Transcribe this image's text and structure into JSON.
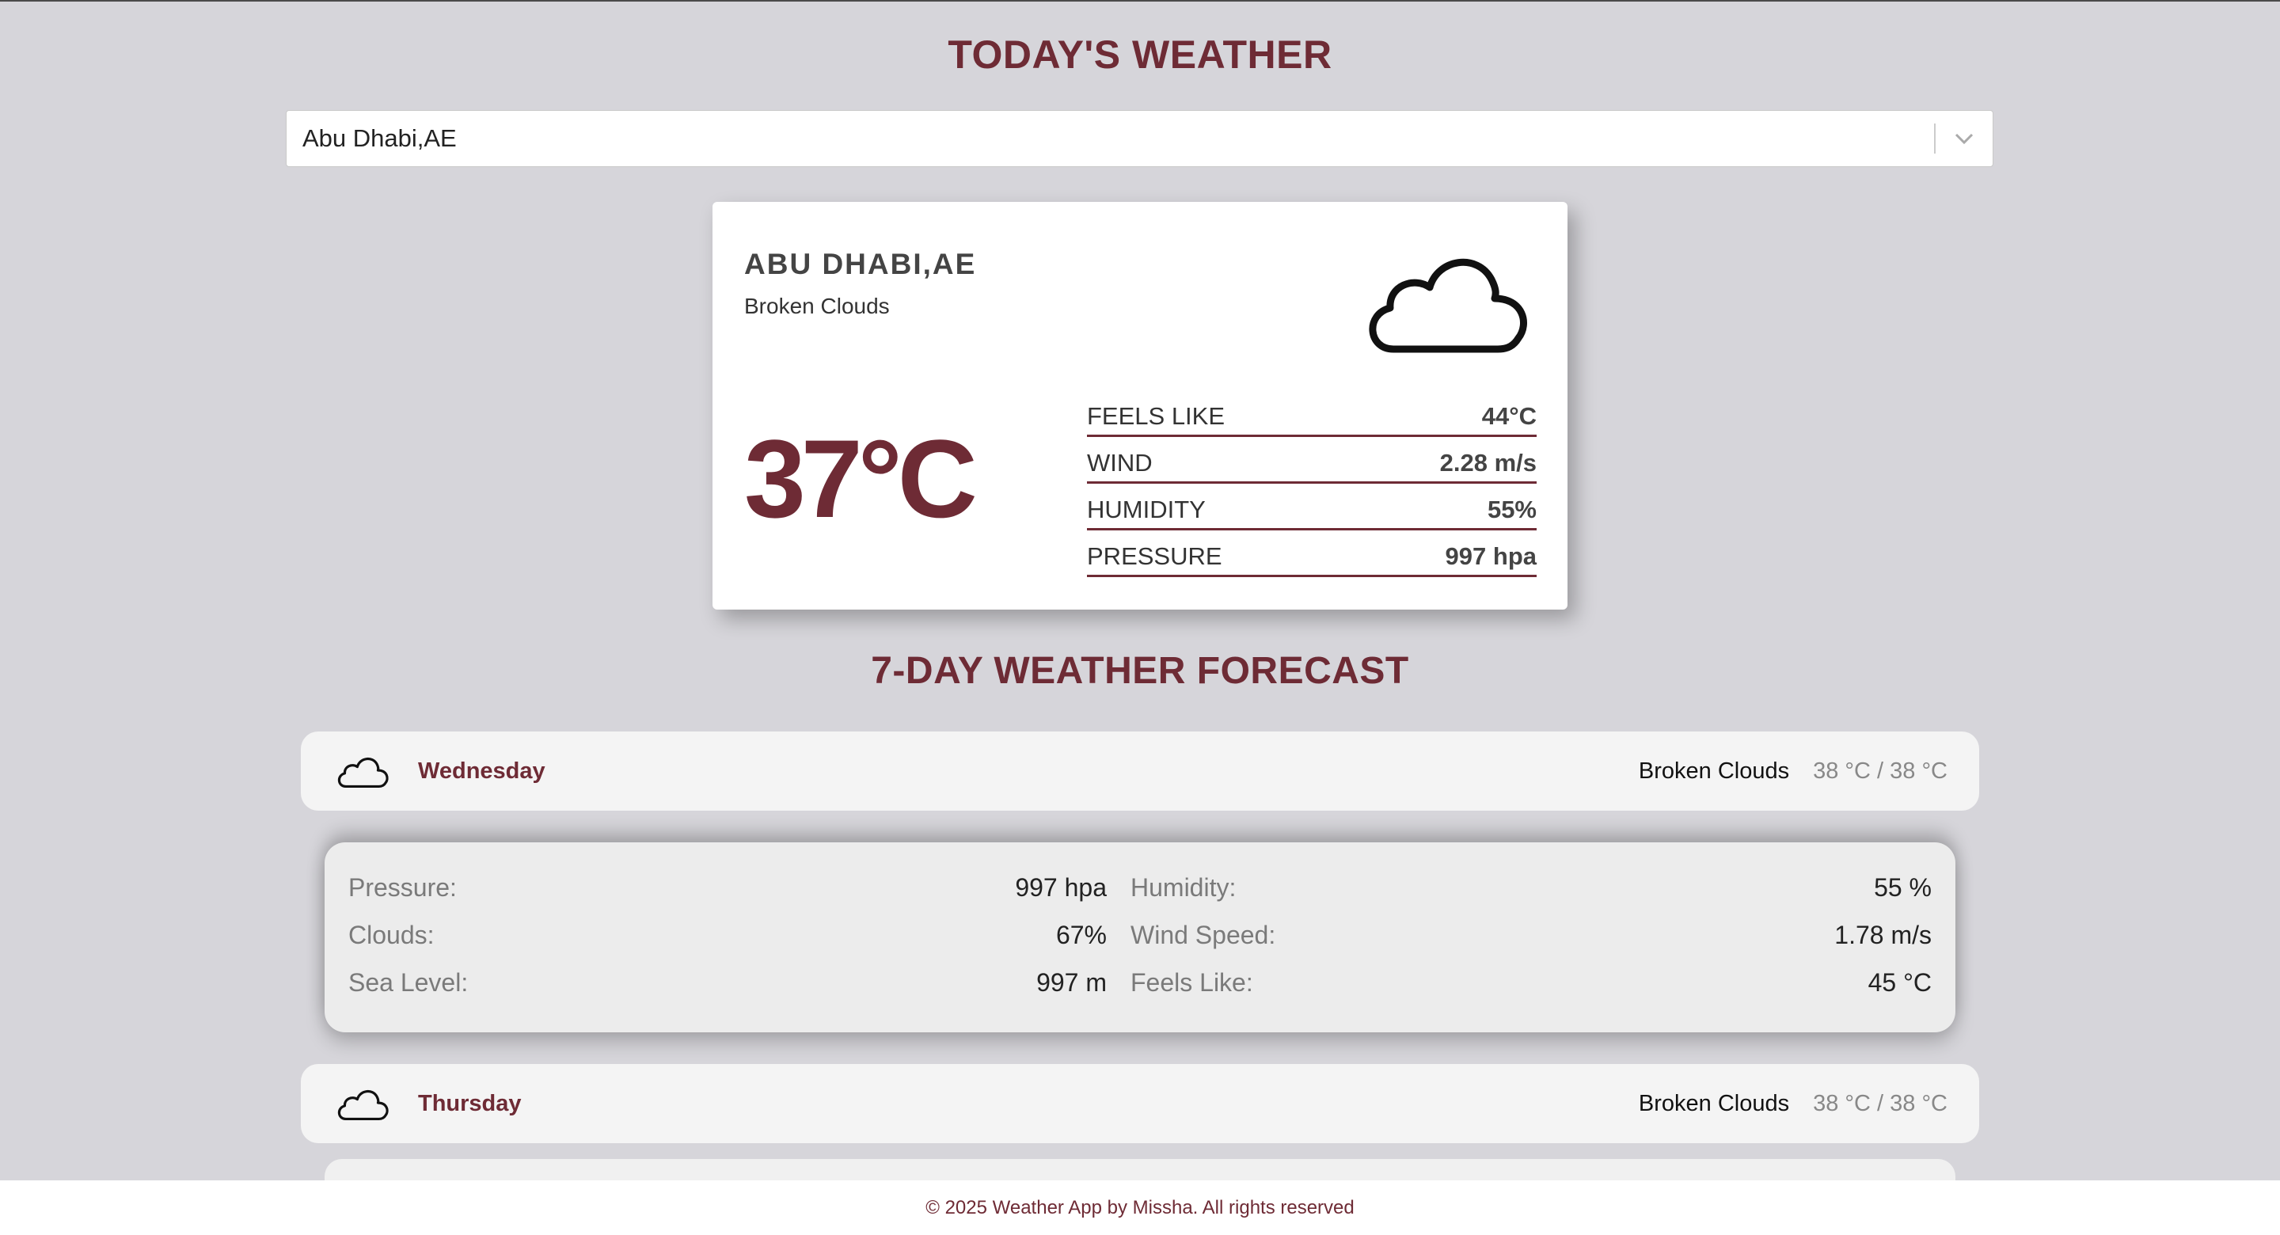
{
  "header": {
    "title": "TODAY'S WEATHER"
  },
  "search": {
    "selected_city": "Abu Dhabi,AE",
    "dropdown_icon": "chevron-down-icon"
  },
  "current": {
    "city": "ABU DHABI,AE",
    "description": "Broken Clouds",
    "icon": "cloud-icon",
    "temperature": "37°C",
    "details": [
      {
        "label": "FEELS LIKE",
        "value": "44°C"
      },
      {
        "label": "WIND",
        "value": "2.28 m/s"
      },
      {
        "label": "HUMIDITY",
        "value": "55%"
      },
      {
        "label": "PRESSURE",
        "value": "997 hpa"
      }
    ]
  },
  "forecast": {
    "title": "7-DAY WEATHER FORECAST",
    "days": [
      {
        "day": "Wednesday",
        "icon": "cloud-icon",
        "description": "Broken Clouds",
        "range": "38 °C / 38 °C"
      },
      {
        "day": "Thursday",
        "icon": "cloud-icon",
        "description": "Broken Clouds",
        "range": "38 °C / 38 °C"
      }
    ],
    "expanded_details": [
      {
        "label": "Pressure:",
        "value": "997 hpa"
      },
      {
        "label": "Humidity:",
        "value": "55 %"
      },
      {
        "label": "Clouds:",
        "value": "67%"
      },
      {
        "label": "Wind Speed:",
        "value": "1.78 m/s"
      },
      {
        "label": "Sea Level:",
        "value": "997 m"
      },
      {
        "label": "Feels Like:",
        "value": "45 °C"
      }
    ]
  },
  "footer": {
    "text": "© 2025 Weather App by Missha. All rights reserved"
  },
  "colors": {
    "accent": "#6e2b35",
    "background": "#d6d5da"
  }
}
